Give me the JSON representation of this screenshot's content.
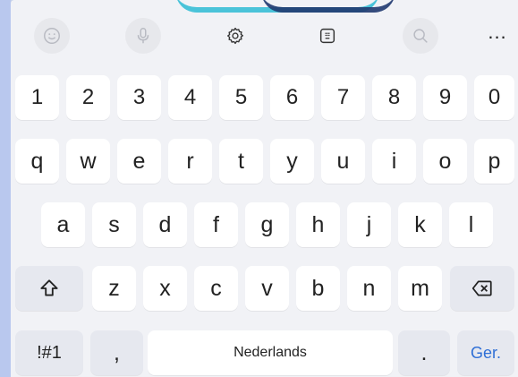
{
  "keyboard": {
    "language": "Nederlands",
    "rows": {
      "numbers": [
        "1",
        "2",
        "3",
        "4",
        "5",
        "6",
        "7",
        "8",
        "9",
        "0"
      ],
      "row1": [
        "q",
        "w",
        "e",
        "r",
        "t",
        "y",
        "u",
        "i",
        "o",
        "p"
      ],
      "row2": [
        "a",
        "s",
        "d",
        "f",
        "g",
        "h",
        "j",
        "k",
        "l"
      ],
      "row3": [
        "z",
        "x",
        "c",
        "v",
        "b",
        "n",
        "m"
      ]
    },
    "symbols_label": "!#1",
    "comma": ",",
    "period": ".",
    "enter_label": "Ger."
  },
  "toolbar": {
    "icons": [
      "emoji-icon",
      "microphone-icon",
      "settings-icon",
      "clipboard-icon",
      "search-icon",
      "more-icon"
    ],
    "more_label": "..."
  },
  "colors": {
    "accent": "#2f6fd6",
    "keyboard_bg": "#f1f2f6",
    "key_bg": "#ffffff",
    "func_key_bg": "#e6e8ef"
  }
}
